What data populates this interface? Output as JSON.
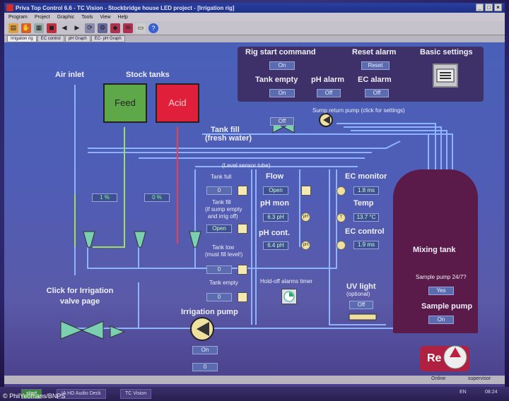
{
  "window": {
    "title": "Priva Top Control 6.6 - TC Vision - Stockbridge house LED project - [Irrigation rig]",
    "controls": [
      "_",
      "□",
      "×"
    ]
  },
  "menu": [
    "Program",
    "Project",
    "Graphic",
    "Tools",
    "View",
    "Help"
  ],
  "tabs": [
    "Irrigation rig",
    "EC control",
    "pH Graph",
    "EC- pH Graph"
  ],
  "panel": {
    "rig_start_label": "Rig start command",
    "rig_start_value": "On",
    "reset_alarm_label": "Reset alarm",
    "reset_alarm_value": "Reset",
    "basic_settings_label": "Basic settings",
    "tank_empty_label": "Tank empty",
    "tank_empty_value": "On",
    "ph_alarm_label": "pH alarm",
    "ph_alarm_value": "Off",
    "ec_alarm_label": "EC alarm",
    "ec_alarm_value": "Off"
  },
  "left": {
    "air_inlet": "Air inlet",
    "stock_tanks": "Stock tanks",
    "feed": "Feed",
    "acid": "Acid",
    "feed_pct": "1 %",
    "acid_pct": "0 %",
    "irrigation_link_1": "Click for Irrigation",
    "irrigation_link_2": "valve page"
  },
  "center": {
    "sump_return": "Sump return pump (click for settings)",
    "tank_fill_value": "Off",
    "tank_fill_1": "Tank fill",
    "tank_fill_2": "(fresh water)",
    "level_sensor": "(Level sensor tube)",
    "tank_full": "Tank full",
    "tank_full_value": "0",
    "tank_fill_sump_1": "Tank fill",
    "tank_fill_sump_2": "(if sump empty",
    "tank_fill_sump_3": "and irrig off)",
    "tank_fill_sump_value": "Open",
    "tank_low_1": "Tank low",
    "tank_low_2": "(must fill level!)",
    "tank_low_value": "0",
    "tank_empty": "Tank empty",
    "tank_empty_value": "0",
    "flow": "Flow",
    "flow_value": "Open",
    "ph_mon": "pH mon",
    "ph_mon_value": "6.3 pH",
    "ph_cont": "pH cont.",
    "ph_cont_value": "6.4 pH",
    "hold_off": "Hold-off alarms timer",
    "irrigation_pump": "Irrigation pump",
    "irrigation_pump_value": "On",
    "irrigation_pump_num": "0",
    "ph_icon": "pH",
    "t_icon": "T"
  },
  "right": {
    "ec_monitor": "EC monitor",
    "ec_monitor_value": "1.8 ms",
    "temp": "Temp",
    "temp_value": "13.7 °C",
    "ec_control": "EC control",
    "ec_control_value": "1.9 ms",
    "uv_light_1": "UV light",
    "uv_light_2": "(optional)",
    "uv_light_value": "Off",
    "mixing_tank": "Mixing tank",
    "sample_pump_24": "Sample pump 24/7?",
    "sample_pump_24_value": "Yes",
    "sample_pump": "Sample pump",
    "sample_pump_value": "On",
    "reset_btn": "Re"
  },
  "status": {
    "online": "Online",
    "user": "supervisor"
  },
  "taskbar": {
    "start": "start",
    "tasks": [
      "IA HD Audio Deck",
      "TC Vision"
    ],
    "lang": "EN",
    "clock": "08:24"
  },
  "credit": "© PhilYeomans/BNPS",
  "colors": {
    "pipe_blue": "#8fb4ff",
    "pipe_green": "#9ee05a",
    "pipe_red": "#ff3a3a",
    "feed": "#5fa84a",
    "acid": "#e0203a"
  }
}
